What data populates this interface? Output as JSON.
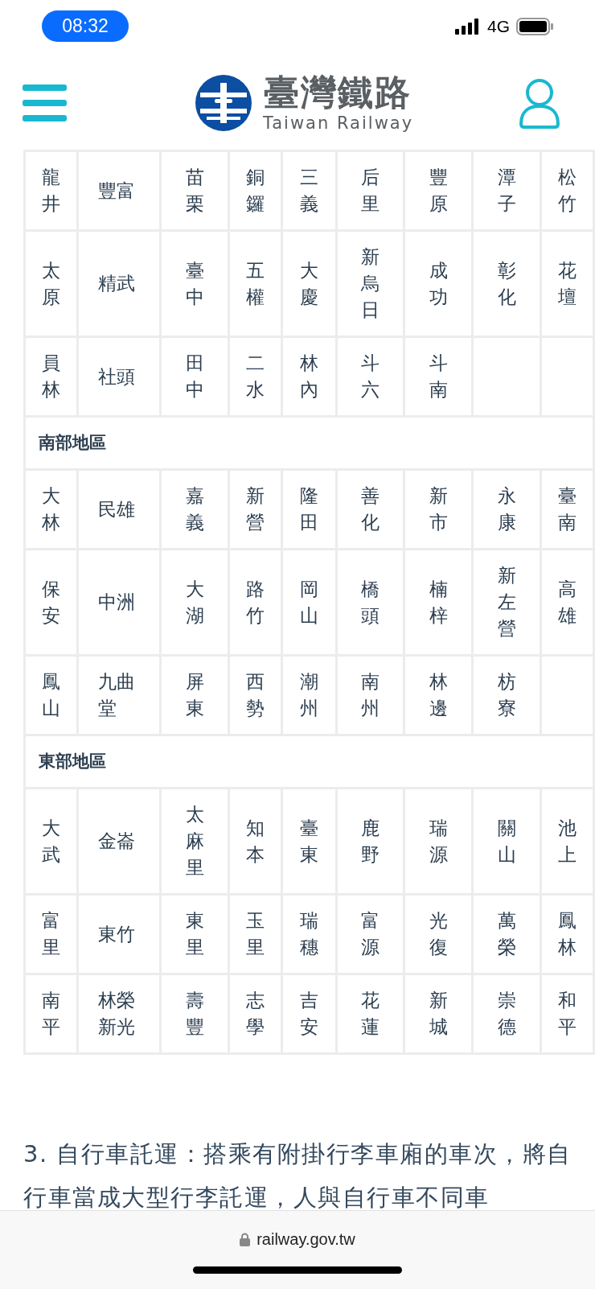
{
  "status_bar": {
    "time": "08:32",
    "network": "4G"
  },
  "header": {
    "logo_title": "臺灣鐵路",
    "logo_subtitle": "Taiwan Railway"
  },
  "station_table": {
    "sections": [
      {
        "rows": [
          [
            "龍井",
            "豐富",
            "苗栗",
            "銅鑼",
            "三義",
            "后里",
            "豐原",
            "潭子",
            "松竹"
          ],
          [
            "太原",
            "精武",
            "臺中",
            "五權",
            "大慶",
            "新烏日",
            "成功",
            "彰化",
            "花壇"
          ],
          [
            "員林",
            "社頭",
            "田中",
            "二水",
            "林內",
            "斗六",
            "斗南"
          ]
        ]
      },
      {
        "title": "南部地區",
        "rows": [
          [
            "大林",
            "民雄",
            "嘉義",
            "新營",
            "隆田",
            "善化",
            "新市",
            "永康",
            "臺南"
          ],
          [
            "保安",
            "中洲",
            "大湖",
            "路竹",
            "岡山",
            "橋頭",
            "楠梓",
            "新左營",
            "高雄"
          ],
          [
            "鳳山",
            "九曲堂",
            "屏東",
            "西勢",
            "潮州",
            "南州",
            "林邊",
            "枋寮"
          ]
        ]
      },
      {
        "title": "東部地區",
        "rows": [
          [
            "大武",
            "金崙",
            "太麻里",
            "知本",
            "臺東",
            "鹿野",
            "瑞源",
            "關山",
            "池上"
          ],
          [
            "富里",
            "東竹",
            "東里",
            "玉里",
            "瑞穗",
            "富源",
            "光復",
            "萬榮",
            "鳳林"
          ],
          [
            "南平",
            "林榮新光",
            "壽豐",
            "志學",
            "吉安",
            "花蓮",
            "新城",
            "崇德",
            "和平"
          ]
        ]
      }
    ]
  },
  "paragraph": "3. 自行車託運：搭乘有附掛行李車廂的車次，將自行車當成大型行李託運，人與自行車不同車",
  "browser": {
    "url": "railway.gov.tw"
  }
}
